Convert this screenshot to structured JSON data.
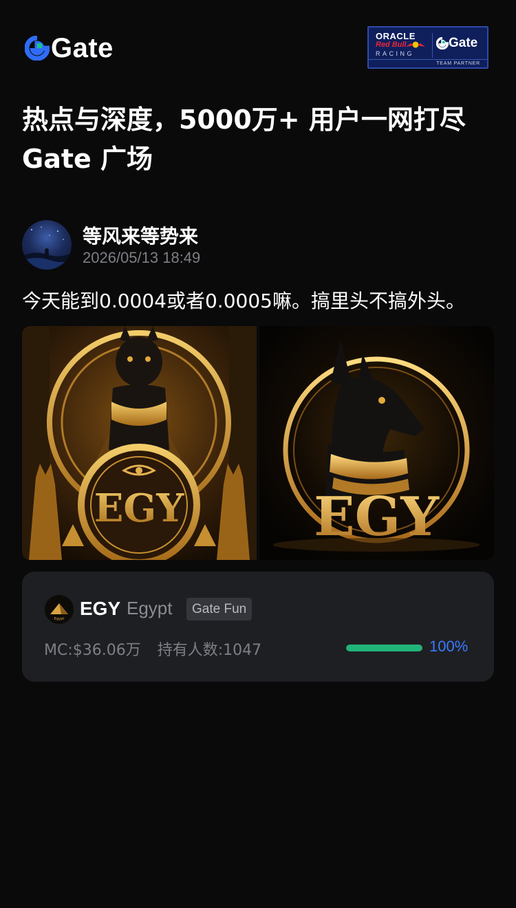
{
  "header": {
    "logo_text": "Gate",
    "partner": {
      "oracle": "ORACLE",
      "redbull": "Red Bull",
      "racing": "RACING",
      "gate": "Gate",
      "team": "TEAM PARTNER"
    }
  },
  "headline": {
    "line1": "热点与深度，5000万+ 用户一网打尽",
    "line2": "Gate 广场"
  },
  "post": {
    "author": "等风来等势来",
    "time": "2026/05/13 18:49",
    "text": "今天能到0.0004或者0.0005嘛。搞里头不搞外头。",
    "images": [
      {
        "icon": "egy-cat-image-1",
        "word": "EGY"
      },
      {
        "icon": "egy-cat-image-2",
        "word": "EGY"
      }
    ]
  },
  "token": {
    "symbol": "EGY",
    "name": "Egypt",
    "tag": "Gate Fun",
    "logo_text": "Egypt",
    "mc": "MC:$36.06万",
    "holders": "持有人数:1047",
    "progress": 1.0,
    "progress_label": "100%"
  },
  "colors": {
    "background": "#0a0a0a",
    "card": "#1e1f23",
    "progress": "#21b37a",
    "accent": "#3b7bff",
    "gold": "#d9a441"
  }
}
